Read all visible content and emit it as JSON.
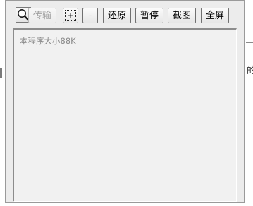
{
  "toolbar": {
    "magnifier_icon": "magnifier-icon",
    "transfer_label": "传输",
    "zoom_in_label": "+",
    "zoom_out_label": "-",
    "restore_label": "还原",
    "pause_label": "暂停",
    "screenshot_label": "截图",
    "fullscreen_label": "全屏"
  },
  "content": {
    "size_text": "本程序大小88K"
  },
  "background": {
    "partial_glyph": "的"
  }
}
